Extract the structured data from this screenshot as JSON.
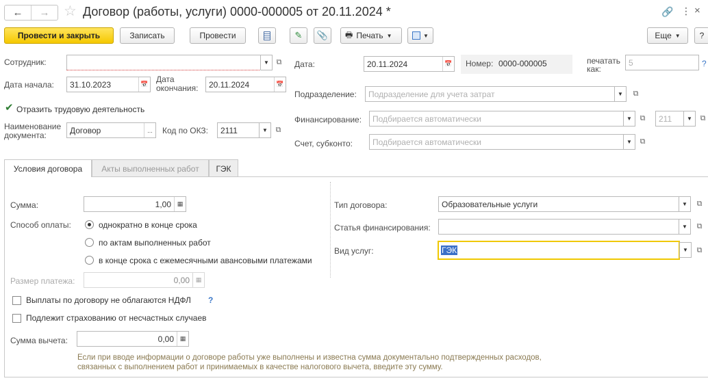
{
  "window": {
    "title": "Договор (работы, услуги) 0000-000005 от 20.11.2024 *"
  },
  "toolbar": {
    "post_close": "Провести и закрыть",
    "save": "Записать",
    "post": "Провести",
    "print": "Печать",
    "more": "Еще",
    "help": "?"
  },
  "header": {
    "employee_label": "Сотрудник:",
    "employee_value": "",
    "date_label": "Дата:",
    "date_value": "20.11.2024",
    "number_label": "Номер:",
    "number_value": "0000-000005",
    "print_as_label": "печатать как:",
    "print_as_value": "5",
    "start_label": "Дата начала:",
    "start_value": "31.10.2023",
    "end_label": "Дата окончания:",
    "end_value": "20.11.2024",
    "department_label": "Подразделение:",
    "department_placeholder": "Подразделение для учета затрат",
    "reflect_label": "Отразить трудовую деятельность",
    "financing_label": "Финансирование:",
    "financing_placeholder": "Подбирается автоматически",
    "financing_code": "211",
    "docname_label": "Наименование документа:",
    "docname_value": "Договор",
    "okz_label": "Код по ОКЗ:",
    "okz_value": "2111",
    "account_label": "Счет, субконто:",
    "account_placeholder": "Подбирается автоматически"
  },
  "tabs": [
    {
      "label": "Условия договора",
      "active": true
    },
    {
      "label": "Акты выполненных работ",
      "active": false
    },
    {
      "label": "ГЭК",
      "active": false
    }
  ],
  "conditions": {
    "sum_label": "Сумма:",
    "sum_value": "1,00",
    "payment_label": "Способ оплаты:",
    "payment_options": [
      {
        "label": "однократно в конце срока",
        "selected": true
      },
      {
        "label": "по актам выполненных работ",
        "selected": false
      },
      {
        "label": "в конце срока с ежемесячными авансовыми платежами",
        "selected": false
      }
    ],
    "payment_size_label": "Размер платежа:",
    "payment_size_value": "0,00",
    "ndfl_label": "Выплаты по договору не облагаются НДФЛ",
    "ndfl_help": "?",
    "insurance_label": "Подлежит страхованию от несчастных случаев",
    "deduction_label": "Сумма вычета:",
    "deduction_value": "0,00",
    "hint": "Если при вводе информации о договоре работы уже выполнены и известна сумма документально подтвержденных расходов, связанных с выполнением работ и принимаемых в качестве налогового вычета, введите эту сумму.",
    "contract_type_label": "Тип договора:",
    "contract_type_value": "Образовательные услуги",
    "fin_article_label": "Статья финансирования:",
    "fin_article_value": "",
    "service_type_label": "Вид услуг:",
    "service_type_value": "ГЭК"
  }
}
